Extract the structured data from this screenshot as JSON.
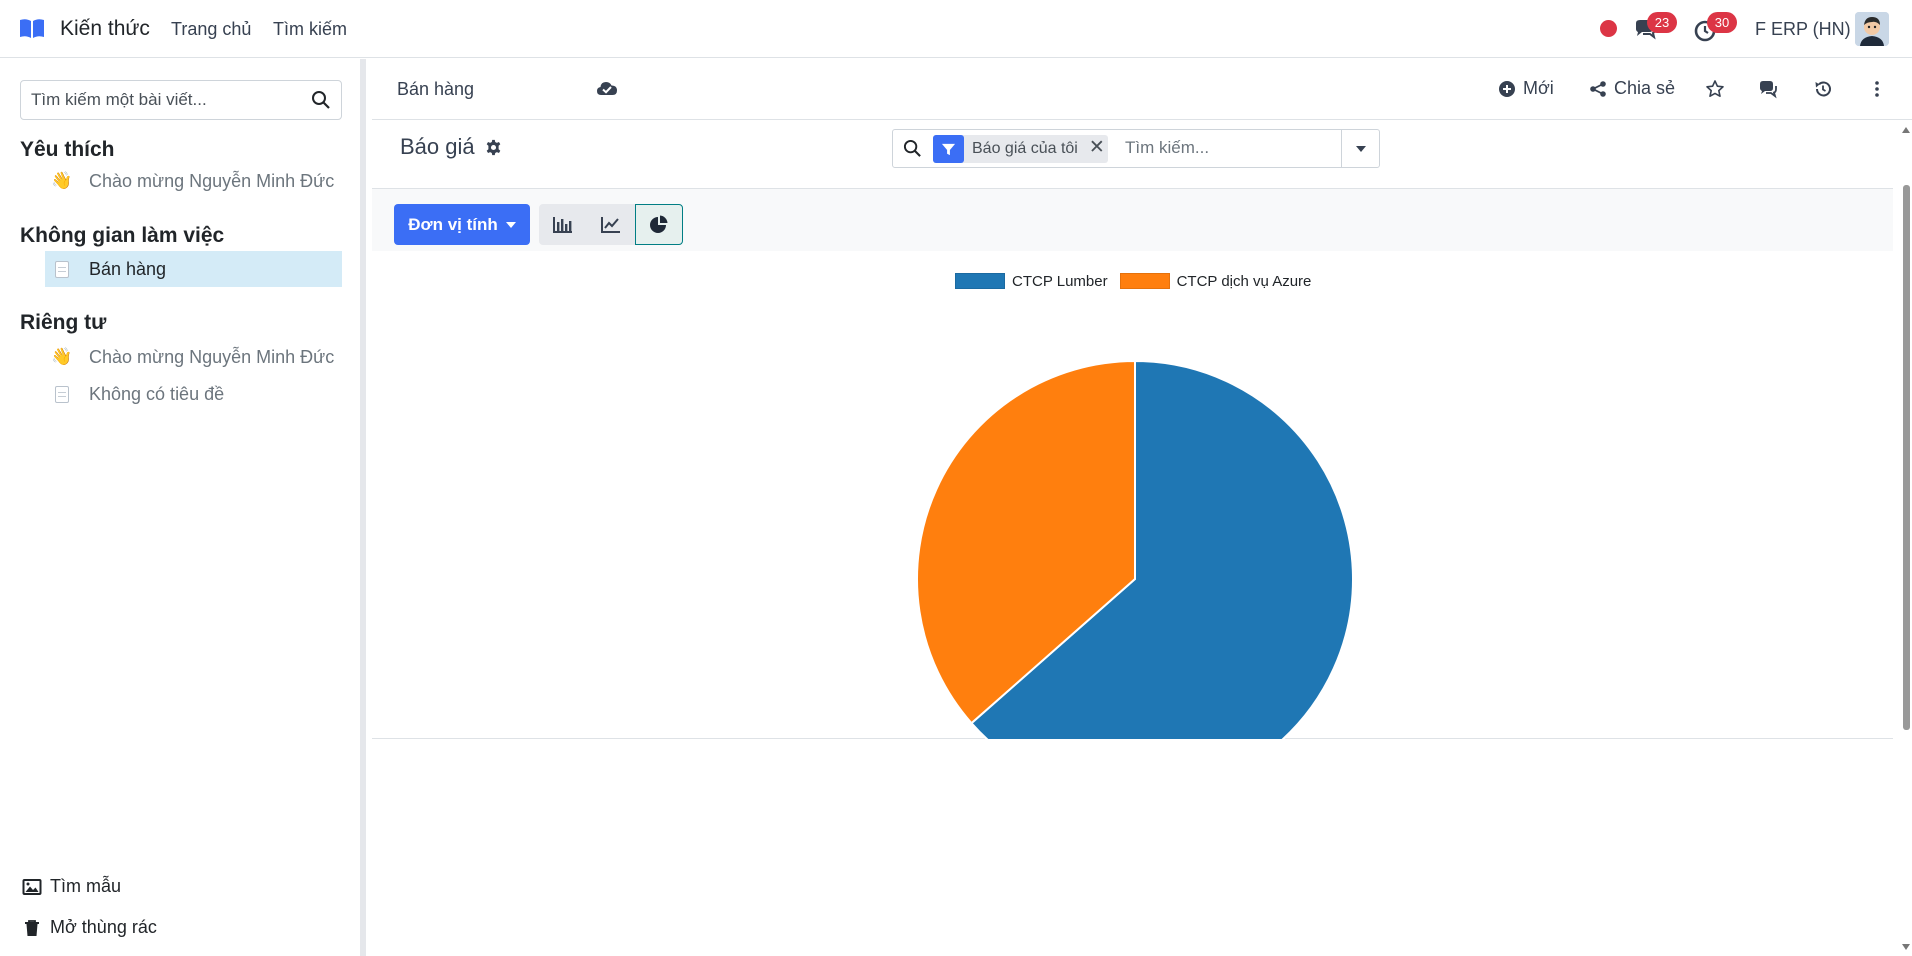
{
  "navbar": {
    "app_name": "Kiến thức",
    "menu": [
      "Trang chủ",
      "Tìm kiếm"
    ],
    "messages_count": "23",
    "activities_count": "30",
    "company": "F ERP (HN)"
  },
  "sidebar": {
    "search_placeholder": "Tìm kiếm một bài viết...",
    "favorites": {
      "title": "Yêu thích",
      "items": [
        {
          "icon": "waving-hand",
          "label": "Chào mừng Nguyễn Minh Đức"
        }
      ]
    },
    "workspace": {
      "title": "Không gian làm việc",
      "items": [
        {
          "icon": "document",
          "label": "Bán hàng",
          "active": true
        }
      ]
    },
    "private": {
      "title": "Riêng tư",
      "items": [
        {
          "icon": "waving-hand",
          "label": "Chào mừng Nguyễn Minh Đức"
        },
        {
          "icon": "document",
          "label": "Không có tiêu đề"
        }
      ]
    },
    "footer": {
      "templates_label": "Tìm mẫu",
      "trash_label": "Mở thùng rác"
    }
  },
  "topbar": {
    "breadcrumb": "Bán hàng",
    "new_label": "Mới",
    "share_label": "Chia sẻ"
  },
  "control_panel": {
    "title": "Báo giá",
    "facet_label": "Báo giá của tôi",
    "search_placeholder": "Tìm kiếm...",
    "measure_label": "Đơn vị tính"
  },
  "colors": {
    "primary": "#3b6ef5",
    "series_1": "#1f77b4",
    "series_2": "#ff7f0e",
    "badge": "#dc3545"
  },
  "chart_data": {
    "type": "pie",
    "series": [
      {
        "name": "CTCP Lumber",
        "value": 63.5,
        "color": "#1f77b4"
      },
      {
        "name": "CTCP dịch vụ Azure",
        "value": 36.5,
        "color": "#ff7f0e"
      }
    ],
    "legend_position": "top-center"
  }
}
